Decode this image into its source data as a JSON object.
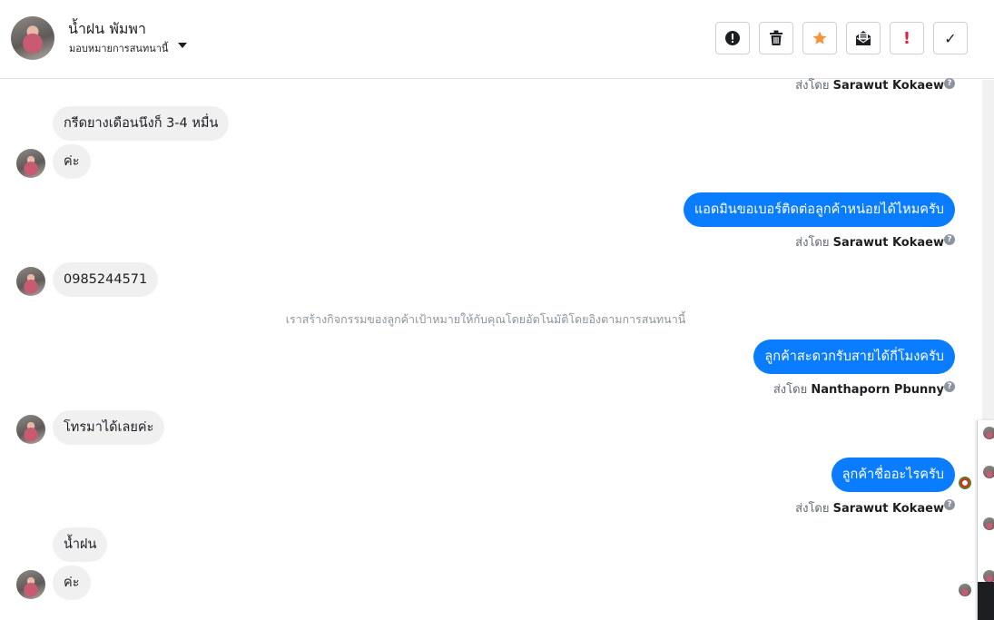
{
  "header": {
    "contact_name": "น้ำฝน พัมพา",
    "assign_label": "มอบหมายการสนทนานี้",
    "toolbar": [
      {
        "name": "spam-button",
        "icon": "alert-circle-icon"
      },
      {
        "name": "delete-button",
        "icon": "trash-icon"
      },
      {
        "name": "star-button",
        "icon": "star-icon",
        "color": "#f7923b"
      },
      {
        "name": "mark-unread-button",
        "icon": "envelope-open-icon"
      },
      {
        "name": "priority-button",
        "icon": "exclamation-icon",
        "color": "#e41e3f",
        "glyph": "!"
      },
      {
        "name": "done-button",
        "icon": "check-icon",
        "glyph": "✓"
      }
    ]
  },
  "messages": {
    "top_sent_by": {
      "prefix": "ส่งโดย",
      "name": "Sarawut Kokaew"
    },
    "m1": "กรีดยางเดือนนึงก็ 3-4 หมื่น",
    "m2": "ค่ะ",
    "m3": "แอดมินขอเบอร์ติดต่อลูกค้าหน่อยได้ไหมครับ",
    "m3_sent_by": {
      "prefix": "ส่งโดย",
      "name": "Sarawut Kokaew"
    },
    "m4": "0985244571",
    "system_note": "เราสร้างกิจกรรมของลูกค้าเป้าหมายให้กับคุณโดยอัตโนมัติโดยอิงตามการสนทนานี้",
    "m5": "ลูกค้าสะดวกรับสายได้กี่โมงครับ",
    "m5_sent_by": {
      "prefix": "ส่งโดย",
      "name": "Nanthaporn Pbunny"
    },
    "m6": "โทรมาได้เลยค่ะ",
    "m7": "ลูกค้าชื่ออะไรครับ",
    "m7_sent_by": {
      "prefix": "ส่งโดย",
      "name": "Sarawut Kokaew"
    },
    "m8": "น้ำฝน",
    "m9": "ค่ะ"
  },
  "colors": {
    "outgoing_bubble": "#0a7cff",
    "incoming_bubble": "#f0f0f0",
    "star": "#f7923b",
    "priority": "#e41e3f"
  }
}
